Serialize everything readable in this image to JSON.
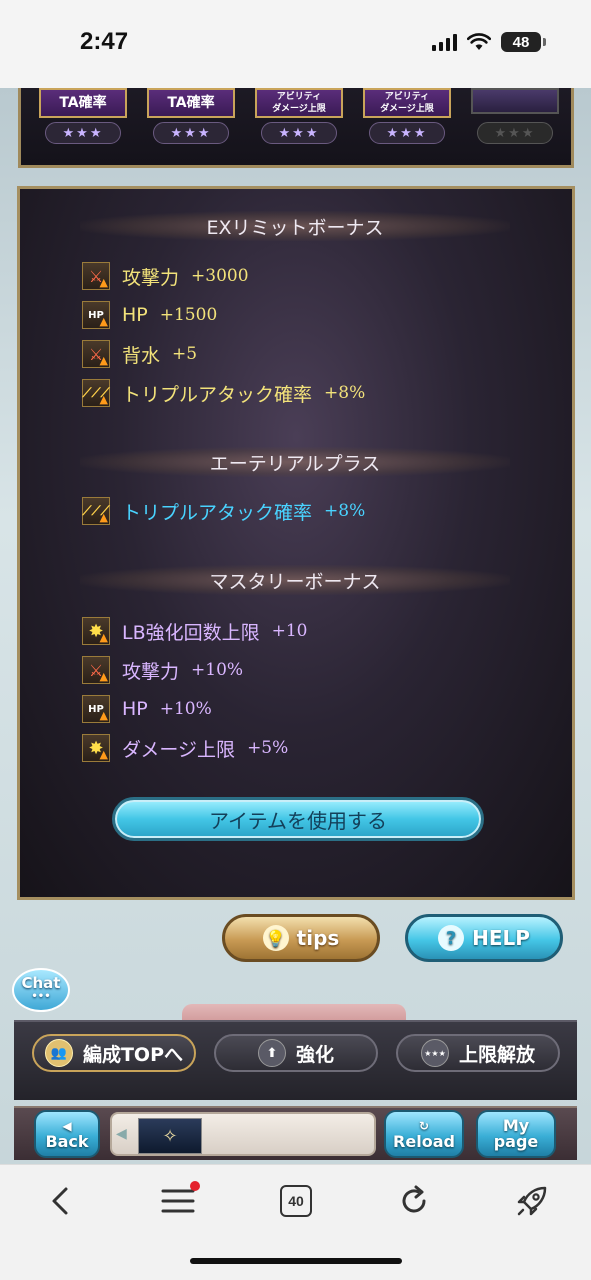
{
  "status": {
    "time": "2:47",
    "battery": "48"
  },
  "top_cards": [
    {
      "label": "TA確率",
      "stars": "★★★"
    },
    {
      "label": "TA確率",
      "stars": "★★★"
    },
    {
      "label": "アビリティ\nダメージ上限",
      "stars": "★★★"
    },
    {
      "label": "アビリティ\nダメージ上限",
      "stars": "★★★"
    },
    {
      "label": "",
      "stars": "★★★"
    }
  ],
  "ex_limit": {
    "title": "EXリミットボーナス",
    "items": [
      {
        "icon": "attack-icon",
        "label": "攻撃力",
        "value": "+3000"
      },
      {
        "icon": "hp-icon",
        "label": "HP",
        "value": "+1500"
      },
      {
        "icon": "attack-icon",
        "label": "背水",
        "value": "+5"
      },
      {
        "icon": "triple-attack-icon",
        "label": "トリプルアタック確率",
        "value": "+8%"
      }
    ]
  },
  "ethereal": {
    "title": "エーテリアルプラス",
    "items": [
      {
        "icon": "triple-attack-icon",
        "label": "トリプルアタック確率",
        "value": "+8%"
      }
    ]
  },
  "mastery": {
    "title": "マスタリーボーナス",
    "items": [
      {
        "icon": "star-burst-icon",
        "label": "LB強化回数上限",
        "value": "+10"
      },
      {
        "icon": "attack-icon",
        "label": "攻撃力",
        "value": "+10%"
      },
      {
        "icon": "hp-icon",
        "label": "HP",
        "value": "+10%"
      },
      {
        "icon": "star-burst-icon",
        "label": "ダメージ上限",
        "value": "+5%"
      }
    ]
  },
  "buttons": {
    "use_item": "アイテムを使用する",
    "tips": "tips",
    "help": "HELP",
    "chat": "Chat",
    "chat_dots": "•••"
  },
  "bottom_tabs": {
    "formation_top": "編成TOPへ",
    "upgrade": "強化",
    "uncap": "上限解放"
  },
  "nav": {
    "back": "Back",
    "reload": "Reload",
    "mypage_line1": "My",
    "mypage_line2": "page"
  },
  "browser": {
    "tab_count": "40"
  },
  "colors": {
    "gold_text": "#f2e27a",
    "blue_text": "#49d3ff",
    "purple_text": "#d9b6ff"
  }
}
